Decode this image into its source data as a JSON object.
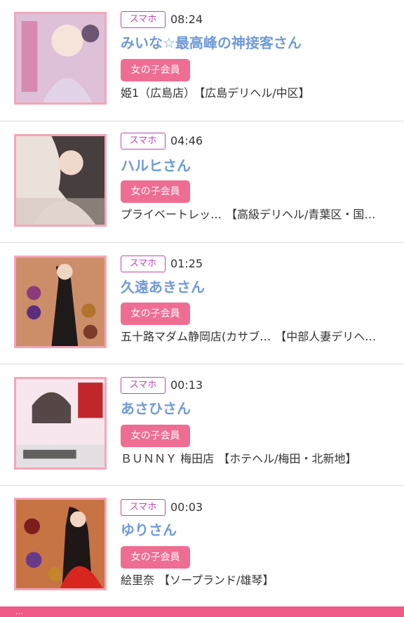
{
  "entries": [
    {
      "device": "スマホ",
      "time": "08:24",
      "name": "みいな☆最高峰の神接客さん",
      "member_label": "女の子会員",
      "shop": "姫1（広島店）",
      "area": "【広島デリヘル/中区】",
      "thumb_colors": [
        "#c9a6c8",
        "#f3dbe7"
      ]
    },
    {
      "device": "スマホ",
      "time": "04:46",
      "name": "ハルヒさん",
      "member_label": "女の子会員",
      "shop": "プライベートレッ…",
      "area": "【高級デリヘル/青葉区・国…",
      "thumb_colors": [
        "#d8cfc8",
        "#f1e6dd"
      ]
    },
    {
      "device": "スマホ",
      "time": "01:25",
      "name": "久遠あきさん",
      "member_label": "女の子会員",
      "shop": "五十路マダム静岡店(カサブ…",
      "area": "【中部人妻デリヘ…",
      "thumb_colors": [
        "#9c2f2a",
        "#e6c28a"
      ]
    },
    {
      "device": "スマホ",
      "time": "00:13",
      "name": "あさひさん",
      "member_label": "女の子会員",
      "shop": "ＢＵＮＮＹ 梅田店",
      "area": "【ホテヘル/梅田・北新地】",
      "thumb_colors": [
        "#e9a3b8",
        "#f7e6ee"
      ]
    },
    {
      "device": "スマホ",
      "time": "00:03",
      "name": "ゆりさん",
      "member_label": "女の子会員",
      "shop": "絵里奈",
      "area": "【ソープランド/雄琴】",
      "thumb_colors": [
        "#a52626",
        "#e3b25e"
      ]
    }
  ],
  "footer": {
    "label": "…"
  }
}
